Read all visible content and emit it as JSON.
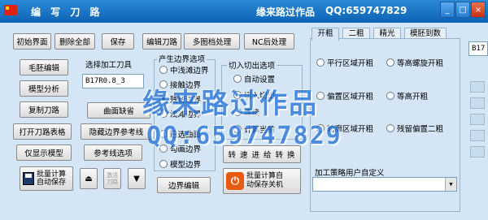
{
  "window": {
    "title": "编 写 刀 路",
    "author": "缘来路过作品",
    "qq": "QQ:659747829",
    "controls": [
      "_",
      "□",
      "×"
    ]
  },
  "toolbar": {
    "init_label": "初始界面",
    "delete_all_label": "删除全部",
    "save_label": "保存",
    "edit_path_label": "编辑刀路",
    "multi_doc_label": "多图档处理",
    "nc_post_label": "NC后处理"
  },
  "left_buttons": {
    "blank_edit": "毛胚编辑",
    "model_analysis": "模型分析",
    "copy_path": "复制刀路",
    "open_path_table": "打开刀路表格",
    "show_model_only": "仅显示模型",
    "batch_calc_save": "批量计算\n自动保存",
    "hide_boundary_params": "隐藏边界参考线",
    "ref_line_select": "参考线选项",
    "surface_missing": "曲面缺省",
    "activate": "激活\n刀路"
  },
  "tool_select": {
    "label": "选择加工刀具",
    "value": "B17R0.8_3"
  },
  "boundary_options": {
    "label": "产生边界选项",
    "items": [
      {
        "label": "中浅滩边界",
        "checked": false
      },
      {
        "label": "接触边界",
        "checked": false
      },
      {
        "label": "残留边界",
        "checked": true
      },
      {
        "label": "浅滩边界",
        "checked": false
      },
      {
        "label": "已选曲面",
        "checked": false
      },
      {
        "label": "勾画边界",
        "checked": false
      },
      {
        "label": "模型边界",
        "checked": false
      }
    ],
    "edit_label": "边界编辑"
  },
  "cut_options": {
    "label": "切入切出选项",
    "items": [
      {
        "label": "自动设置",
        "checked": false
      },
      {
        "label": "切入切出",
        "checked": false
      },
      {
        "label": "连接",
        "checked": false
      },
      {
        "label": "计算当前",
        "checked": false
      }
    ],
    "convert_label": "转 速 进 给 转 换",
    "batch_shutdown_label": "批量计算自\n动保存关机"
  },
  "tabs": [
    {
      "label": "开粗",
      "active": true
    },
    {
      "label": "二粗",
      "active": false
    },
    {
      "label": "精光",
      "active": false
    },
    {
      "label": "模胚到数",
      "active": false
    }
  ],
  "strategies": [
    {
      "label": "平行区域开粗",
      "checked": false
    },
    {
      "label": "等高螺旋开粗",
      "checked": false
    },
    {
      "label": "偏置区域开粗",
      "checked": false
    },
    {
      "label": "等高开粗",
      "checked": false
    },
    {
      "label": "轮廓区域开粗",
      "checked": false
    },
    {
      "label": "残留偏置二粗",
      "checked": false
    }
  ],
  "custom_strategy": {
    "label": "加工策略用户自定义",
    "value": ""
  },
  "right_field": "B17",
  "watermark": {
    "line1": "缘来路过作品",
    "line2": "QQ:659747829"
  }
}
